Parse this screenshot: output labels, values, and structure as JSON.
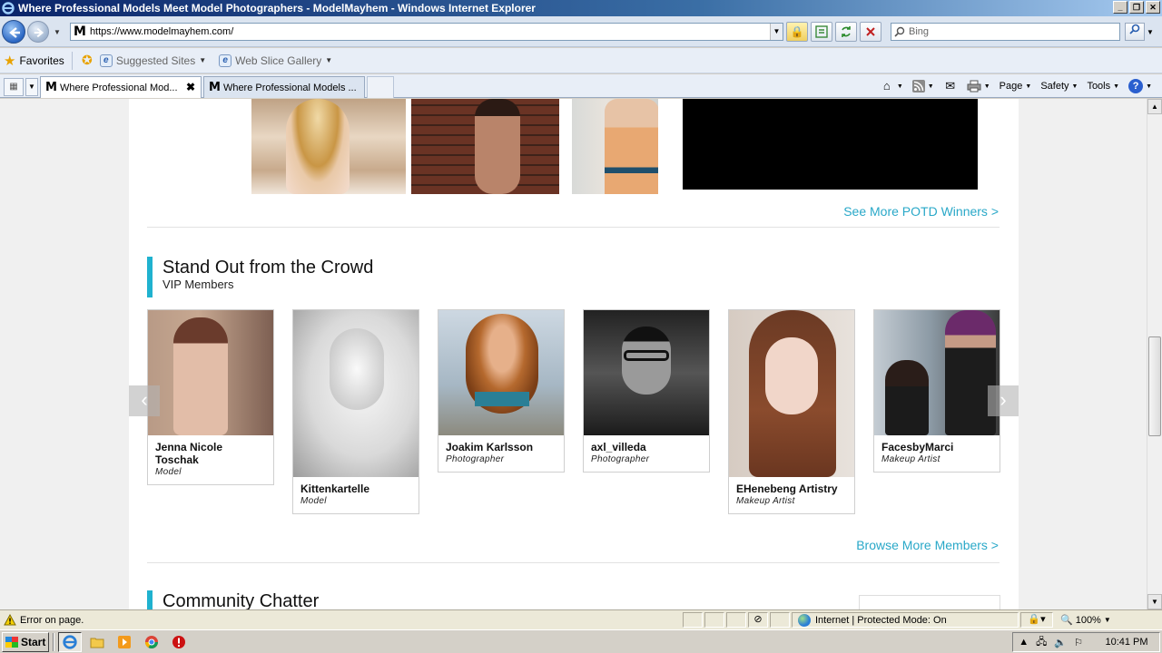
{
  "window": {
    "title": "Where Professional Models Meet Model Photographers - ModelMayhem - Windows Internet Explorer",
    "minimize": "_",
    "restore": "❐",
    "close": "✕"
  },
  "address_bar": {
    "url": "https://www.modelmayhem.com/",
    "site_icon": "M",
    "search_placeholder": "Bing"
  },
  "favorites_bar": {
    "favorites_label": "Favorites",
    "links": [
      {
        "label": "Suggested Sites"
      },
      {
        "label": "Web Slice Gallery"
      }
    ]
  },
  "tabs": [
    {
      "title": "Where Professional Mod...",
      "close": "✖"
    },
    {
      "title": "Where Professional Models ..."
    }
  ],
  "command_bar": {
    "page": "Page",
    "safety": "Safety",
    "tools": "Tools",
    "help": "?"
  },
  "page": {
    "potd_link": "See More POTD Winners >",
    "vip_section": {
      "title": "Stand Out from the Crowd",
      "subtitle": "VIP Members"
    },
    "members": [
      {
        "name": "Jenna Nicole Toschak",
        "role": "Model"
      },
      {
        "name": "Kittenkartelle",
        "role": "Model"
      },
      {
        "name": "Joakim Karlsson",
        "role": "Photographer"
      },
      {
        "name": "axl_villeda",
        "role": "Photographer"
      },
      {
        "name": "EHenebeng Artistry",
        "role": "Makeup Artist"
      },
      {
        "name": "FacesbyMarci",
        "role": "Makeup Artist"
      }
    ],
    "carousel_prev": "‹",
    "carousel_next": "›",
    "browse_link": "Browse More Members >",
    "community_section": {
      "title": "Community Chatter"
    }
  },
  "status_bar": {
    "message": "Error on page.",
    "zone": "Internet | Protected Mode: On",
    "zoom": "100%"
  },
  "taskbar": {
    "start": "Start",
    "clock": "10:41 PM"
  },
  "colors": {
    "accent_cyan": "#29a8c8",
    "section_bar": "#1fb2cf"
  }
}
